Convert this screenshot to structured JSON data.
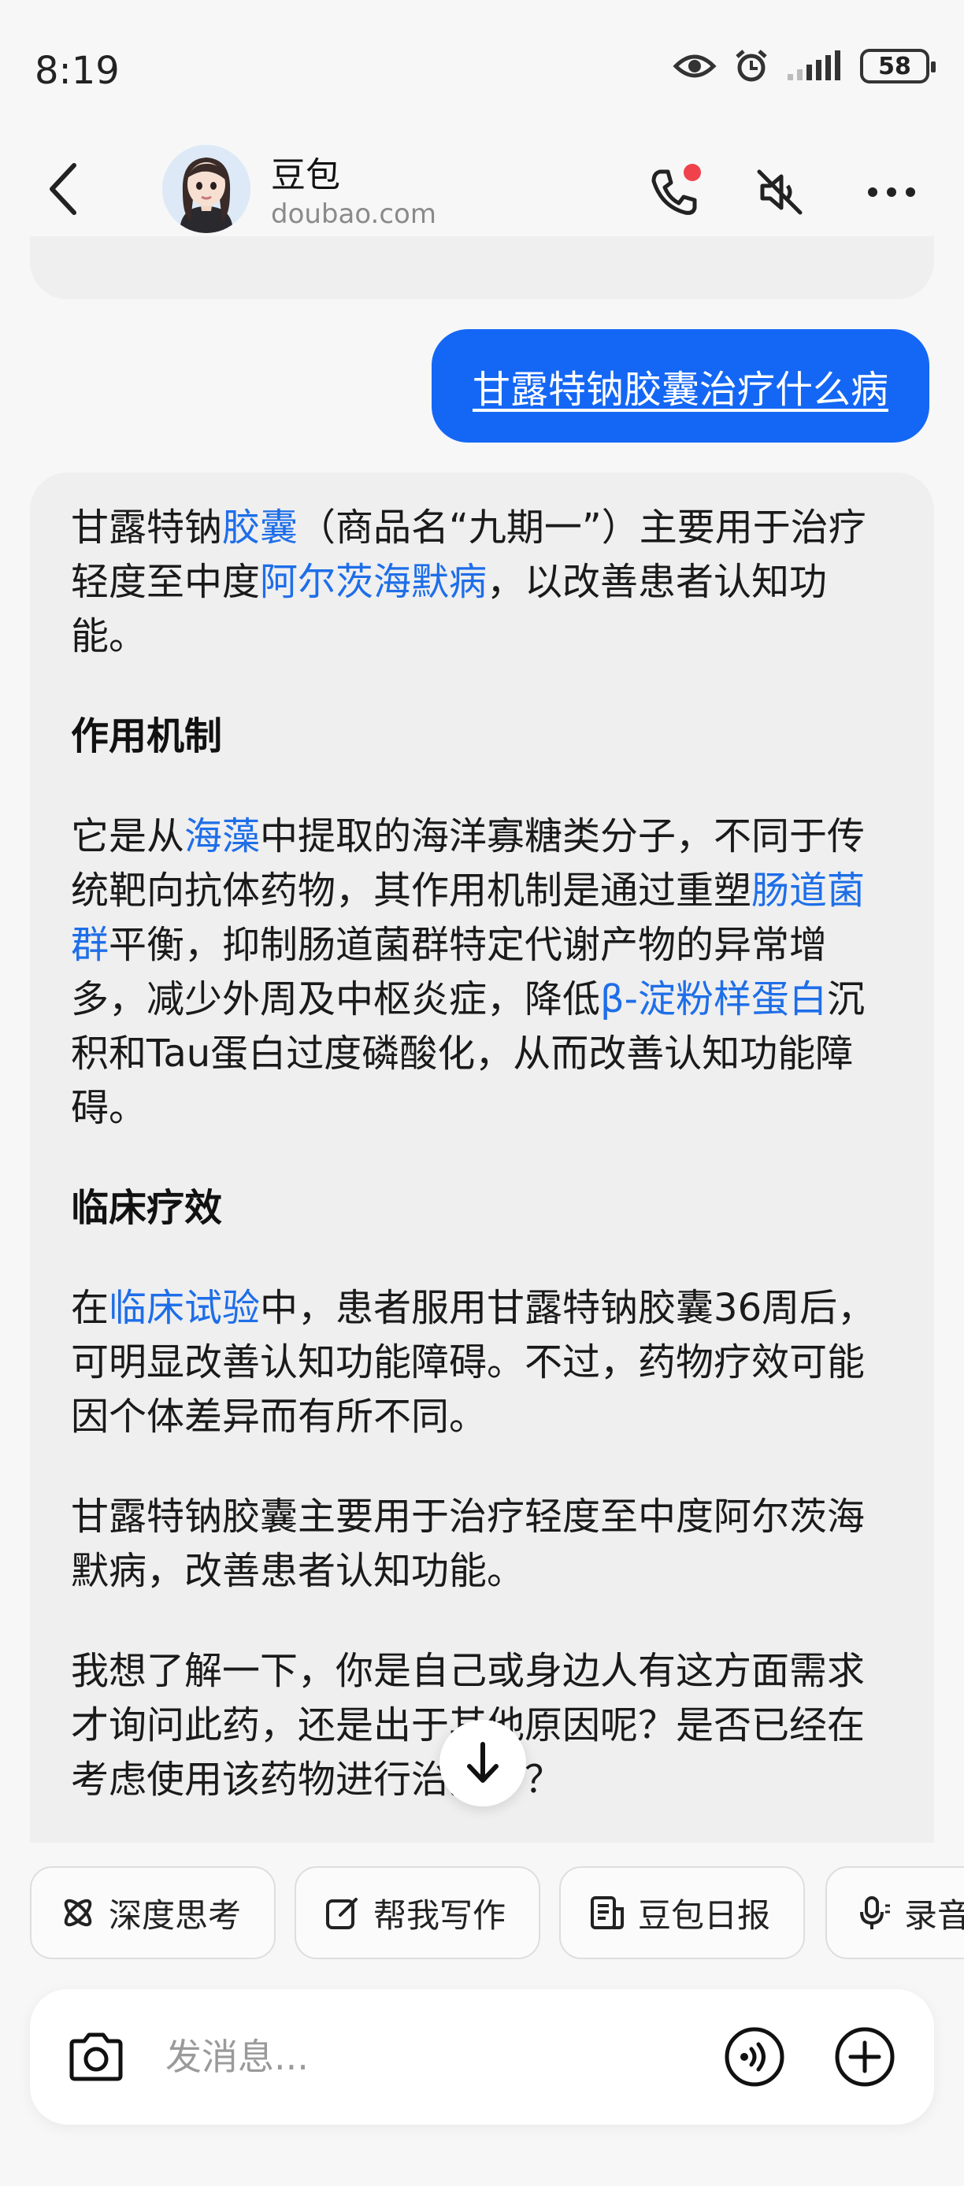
{
  "status_bar": {
    "time": "8:19",
    "battery": "58",
    "icons": [
      "eye-icon",
      "alarm-icon",
      "signal-icon",
      "battery-icon"
    ]
  },
  "header": {
    "name": "豆包",
    "domain": "doubao.com",
    "notification_dot_color": "#f0424a"
  },
  "chat": {
    "user_message": "甘露特钠胶囊治疗什么病",
    "ai_message": {
      "intro": {
        "pre": "甘露特钠",
        "link1": "胶囊",
        "mid": "（商品名“九期一”）主要用于治疗轻度至中度",
        "link2": "阿尔茨海默病",
        "post": "，以改善患者认知功能。"
      },
      "section1_title": "作用机制",
      "section1": {
        "pre": "它是从",
        "link1": "海藻",
        "mid1": "中提取的海洋寡糖类分子，不同于传统靶向抗体药物，其作用机制是通过重塑",
        "link2": "肠道菌群",
        "mid2": "平衡，抑制肠道菌群特定代谢产物的异常增多，减少外周及中枢炎症，降低",
        "link3": "β-淀粉样蛋白",
        "post": "沉积和Tau蛋白过度磷酸化，从而改善认知功能障碍。"
      },
      "section2_title": "临床疗效",
      "section2": {
        "pre": "在",
        "link1": "临床试验",
        "post": "中，患者服用甘露特钠胶囊36周后，可明显改善认知功能障碍。不过，药物疗效可能因个体差异而有所不同。"
      },
      "summary": "甘露特钠胶囊主要用于治疗轻度至中度阿尔茨海默病，改善患者认知功能。",
      "followup": "我想了解一下，你是自己或身边人有这方面需求才询问此药，还是出于其他原因呢？是否已经在考虑使用该药物进行治疗了？"
    },
    "link_color": "#1e6ee8",
    "user_bubble_color": "#1467f5"
  },
  "chips": [
    {
      "label": "深度思考",
      "icon": "atom-icon"
    },
    {
      "label": "帮我写作",
      "icon": "edit-icon"
    },
    {
      "label": "豆包日报",
      "icon": "newspaper-icon"
    },
    {
      "label": "录音",
      "icon": "microphone-icon"
    }
  ],
  "input": {
    "placeholder": "发消息..."
  }
}
